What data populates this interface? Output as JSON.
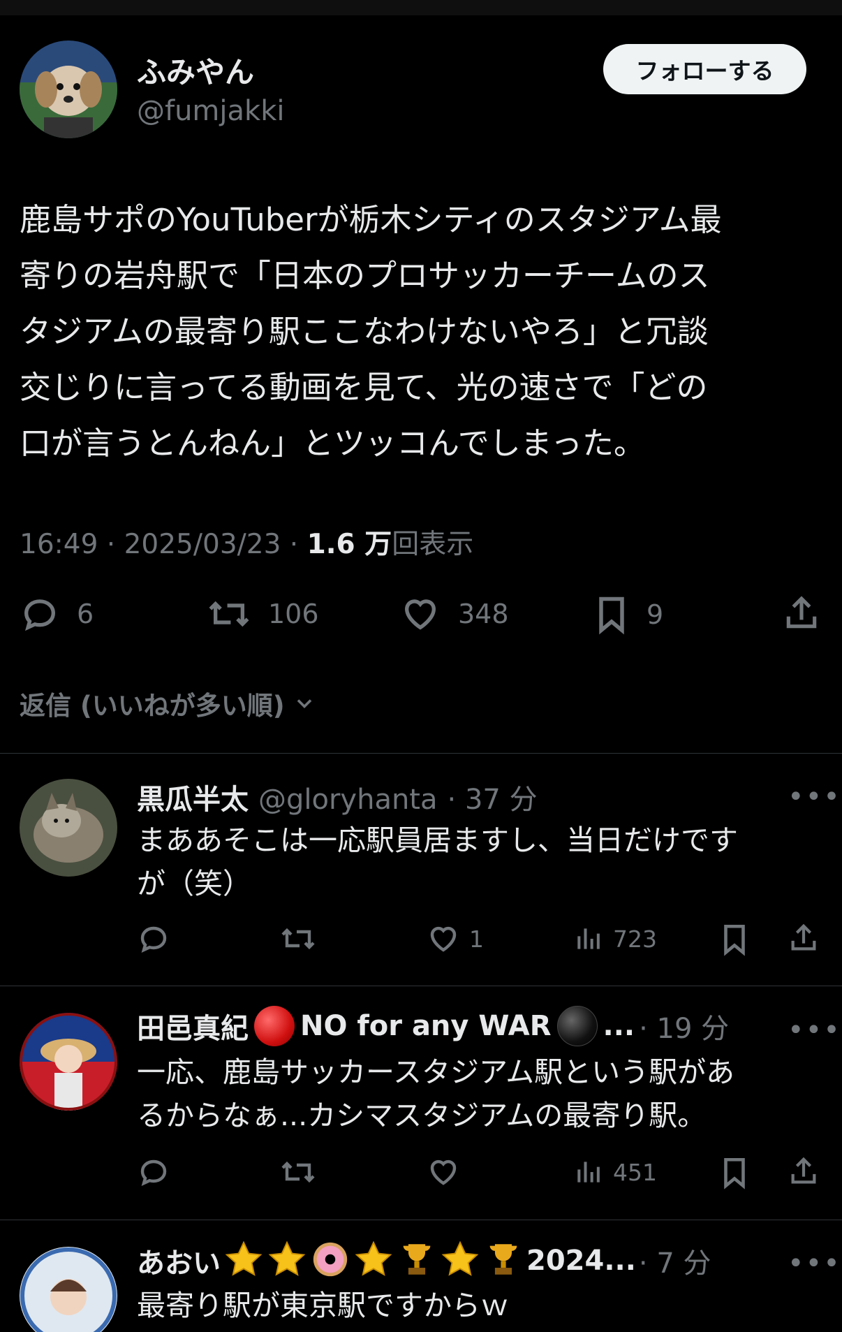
{
  "tweet": {
    "author_name": "ふみやん",
    "author_handle": "@fumjakki",
    "follow_label": "フォローする",
    "text": "鹿島サポのYouTuberが栃木シティのスタジアム最\n寄りの岩舟駅で「日本のプロサッカーチームのス\nタジアムの最寄り駅ここなわけないやろ」と冗談\n交じりに言ってる動画を見て、光の速さで「どの\n口が言うとんねん」とツッコんでしまった。",
    "time": "16:49",
    "date": "2025/03/23",
    "views_count": "1.6 万",
    "views_label": "回表示",
    "replies": "6",
    "retweets": "106",
    "likes": "348",
    "bookmarks": "9"
  },
  "sort_label": "返信 (いいねが多い順)",
  "replies": [
    {
      "name": "黒瓜半太",
      "handle": "@gloryhanta",
      "time": "37 分",
      "text": "まああそこは一応駅員居ますし、当日だけです\nが（笑）",
      "likes": "1",
      "views": "723"
    },
    {
      "name_part1": "田邑真紀",
      "name_part2": "NO for any WAR",
      "name_suffix": "...",
      "time": "19 分",
      "text": "一応、鹿島サッカースタジアム駅という駅があ\nるからなぁ...カシマスタジアムの最寄り駅。",
      "likes": "",
      "views": "451"
    },
    {
      "name_part1": "あおい",
      "name_part2": "2024...",
      "time": "7 分",
      "text": "最寄り駅が東京駅ですからｗ"
    }
  ],
  "icons": {
    "reply": "reply-icon",
    "retweet": "retweet-icon",
    "like": "heart-icon",
    "bookmark": "bookmark-icon",
    "share": "share-icon",
    "views": "views-icon",
    "more": "more-icon"
  }
}
